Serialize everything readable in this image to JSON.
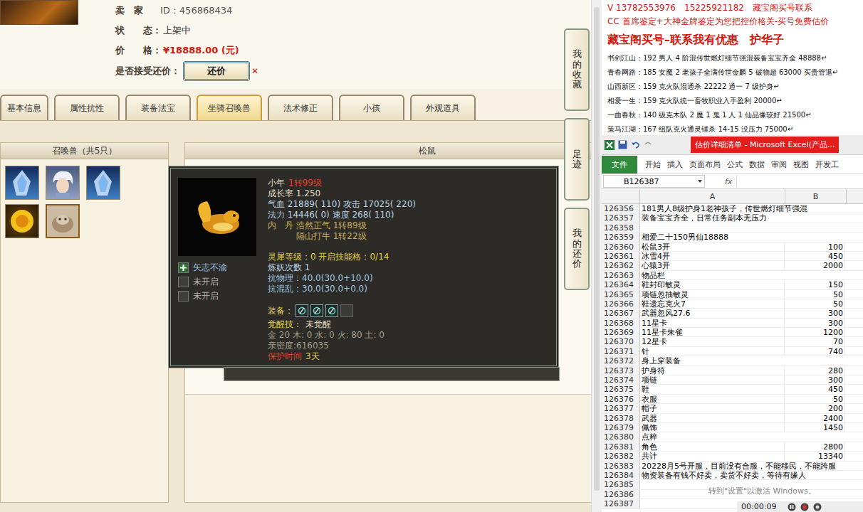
{
  "listing": {
    "info": [
      {
        "label": "卖　家",
        "value": "ID：456868434",
        "kind": "id"
      },
      {
        "label": "状　　态：",
        "value": "上架中",
        "kind": "status"
      },
      {
        "label": "价　　格：",
        "value": "¥18888.00 (元)",
        "kind": "price"
      }
    ],
    "bargain": {
      "label": "是否接受还价：",
      "button": "还价",
      "close": "✕"
    }
  },
  "tabs": [
    {
      "label": "基本信息",
      "selected": false
    },
    {
      "label": "属性抗性",
      "selected": false
    },
    {
      "label": "装备法宝",
      "selected": false
    },
    {
      "label": "坐骑召唤兽",
      "selected": true
    },
    {
      "label": "法术修正",
      "selected": false
    },
    {
      "label": "小孩",
      "selected": false
    },
    {
      "label": "外观道具",
      "selected": false
    }
  ],
  "side_buttons": [
    "我的收藏",
    "足迹",
    "我的还价"
  ],
  "pets": {
    "title": "召唤兽（共5只）",
    "items": [
      {
        "kind": "ice",
        "selected": false
      },
      {
        "kind": "sage",
        "selected": false
      },
      {
        "kind": "ice",
        "selected": false
      },
      {
        "kind": "gold",
        "selected": false
      },
      {
        "kind": "squirrel",
        "selected": true
      }
    ]
  },
  "detail": {
    "title": "松鼠"
  },
  "tooltip": {
    "skills": [
      {
        "name": "矢志不渝",
        "open": true
      },
      {
        "name": "未开启",
        "open": false
      },
      {
        "name": "未开启",
        "open": false
      }
    ],
    "lines_top": [
      [
        {
          "text": "小年",
          "color": "#e6dfc8"
        },
        {
          "text": "1转99级",
          "color": "#e0402c"
        }
      ],
      [
        {
          "text": "成长率 1.250",
          "color": "#e6dfc8"
        }
      ],
      [
        {
          "text": "气血 21889( 110) 攻击 17025( 220)",
          "color": "#bcd3e6"
        }
      ],
      [
        {
          "text": "法力 14446( 0) 速度 268( 110)",
          "color": "#bcd3e6"
        }
      ],
      [
        {
          "text": "内　丹 浩然正气 1转89级",
          "color": "#c9ad62"
        }
      ],
      [
        {
          "text": "　　　 隔山打牛 1转22级",
          "color": "#c9ad62"
        }
      ]
    ],
    "lines_mid": [
      [
        {
          "text": "灵犀等级：0 开启技能格：0/14",
          "color": "#e2d24a"
        }
      ],
      [
        {
          "text": "炼妖次数 1",
          "color": "#bcd3e6"
        }
      ],
      [
        {
          "text": "抗物理：40.0(30.0+10.0)",
          "color": "#9fc4e0"
        }
      ],
      [
        {
          "text": "抗混乱：30.0(30.0+0.0)",
          "color": "#9fc4e0"
        }
      ]
    ],
    "equip": {
      "label": "装备：",
      "color": "#e2d24a",
      "slots": [
        {
          "filled": true
        },
        {
          "filled": true
        },
        {
          "filled": true
        },
        {
          "filled": false
        }
      ]
    },
    "lines_bottom": [
      [
        {
          "text": "觉醒技：",
          "color": "#e2d24a"
        },
        {
          "text": "未觉醒",
          "color": "#e6dfc8"
        }
      ],
      [
        {
          "text": "金 20 木: 0 水: 0 火: 80 土: 0",
          "color": "#a59f8c"
        }
      ],
      [
        {
          "text": "亲密度:616035",
          "color": "#a59f8c"
        }
      ],
      [
        {
          "text": "保护时间",
          "color": "#e0402c"
        },
        {
          "text": "3天",
          "color": "#e2d24a"
        }
      ]
    ]
  },
  "ad": {
    "header": [
      "V 13782553976　15225921182　藏宝阁买号联系",
      "CC 首席鉴定+大神金牌鉴定为您把控价格关-买号免费估价"
    ],
    "title": "藏宝阁买号–联系我有优惠　护华子",
    "lines": [
      "书剑江山：192 男人 4 阶混传世燃灯细节强混装备宝宝齐全 48888↵",
      "青春网路：185 女魔 2 老孩子全满传世金麟 5 破物超 63000 买贵管退↵",
      "山西新区：159 克火队混通杀 22222 通一 7 级护身↵",
      "相爱一生：159 克火队统一畜牧职业入手盈利 20000↵",
      "一曲春秋：140 级克木队 2 魔 1 鬼 1 人 1 仙品像较好 21500↵",
      "策马江湖：167 组队克火通灵锤杀 14-15 没压力 75000↵"
    ]
  },
  "excel": {
    "title": "估价详细清单 - Microsoft Excel(产品...",
    "ribbon": [
      {
        "label": "文件",
        "selected": true
      },
      {
        "label": "开始",
        "selected": false
      },
      {
        "label": "插入",
        "selected": false
      },
      {
        "label": "页面布局",
        "selected": false
      },
      {
        "label": "公式",
        "selected": false
      },
      {
        "label": "数据",
        "selected": false
      },
      {
        "label": "审阅",
        "selected": false
      },
      {
        "label": "视图",
        "selected": false
      },
      {
        "label": "开发工",
        "selected": false
      }
    ],
    "name_box": "B126387",
    "fx": "fx",
    "columns": [
      "A",
      "B"
    ],
    "rows": [
      {
        "num": "126356",
        "a": "181男人8级护身1老神孩子，传世燃灯细节强混",
        "b": ""
      },
      {
        "num": "126357",
        "a": "装备宝宝齐全，日常任务副本无压力",
        "b": ""
      },
      {
        "num": "126358",
        "a": "",
        "b": ""
      },
      {
        "num": "126359",
        "a": "相爱二十150男仙18888",
        "b": ""
      },
      {
        "num": "126360",
        "a": "松鼠3开",
        "b": "100"
      },
      {
        "num": "126361",
        "a": "冰雪4开",
        "b": "450"
      },
      {
        "num": "126362",
        "a": "心猿3开",
        "b": "2000"
      },
      {
        "num": "126363",
        "a": "物品栏",
        "b": ""
      },
      {
        "num": "126364",
        "a": "鞋封印敏灵",
        "b": "150"
      },
      {
        "num": "126365",
        "a": "项链忽抽敏灵",
        "b": "50"
      },
      {
        "num": "126366",
        "a": "鞋遗忘克火7",
        "b": "50"
      },
      {
        "num": "126367",
        "a": "武器忽风27.6",
        "b": "300"
      },
      {
        "num": "126368",
        "a": "11星卡",
        "b": "300"
      },
      {
        "num": "126369",
        "a": "11星卡朱雀",
        "b": "1200"
      },
      {
        "num": "126370",
        "a": "12星卡",
        "b": "70"
      },
      {
        "num": "126371",
        "a": "针",
        "b": "740"
      },
      {
        "num": "126372",
        "a": "身上穿装备",
        "b": ""
      },
      {
        "num": "126373",
        "a": "护身符",
        "b": "280"
      },
      {
        "num": "126374",
        "a": "项链",
        "b": "300"
      },
      {
        "num": "126375",
        "a": "鞋",
        "b": "450"
      },
      {
        "num": "126376",
        "a": "衣服",
        "b": "50"
      },
      {
        "num": "126377",
        "a": "帽子",
        "b": "200"
      },
      {
        "num": "126378",
        "a": "武器",
        "b": "2400"
      },
      {
        "num": "126379",
        "a": "佩饰",
        "b": "1450"
      },
      {
        "num": "126380",
        "a": "点粹",
        "b": ""
      },
      {
        "num": "126381",
        "a": "角色",
        "b": "2800"
      },
      {
        "num": "126382",
        "a": "共计",
        "b": "13340"
      },
      {
        "num": "126383",
        "a": "20228月5号开服，目前没有合服，不能移民，不能跨服",
        "b": ""
      },
      {
        "num": "126384",
        "a": "物资装备有钱不好卖，卖货不好卖，等待有缘人",
        "b": ""
      },
      {
        "num": "126385",
        "a": "",
        "b": ""
      },
      {
        "num": "126386",
        "a": "",
        "b": ""
      },
      {
        "num": "126387",
        "a": "",
        "b": ""
      }
    ],
    "watermark": "转到\"设置\"以激活 Windows。"
  },
  "recorder": {
    "time": "00:00:09"
  }
}
